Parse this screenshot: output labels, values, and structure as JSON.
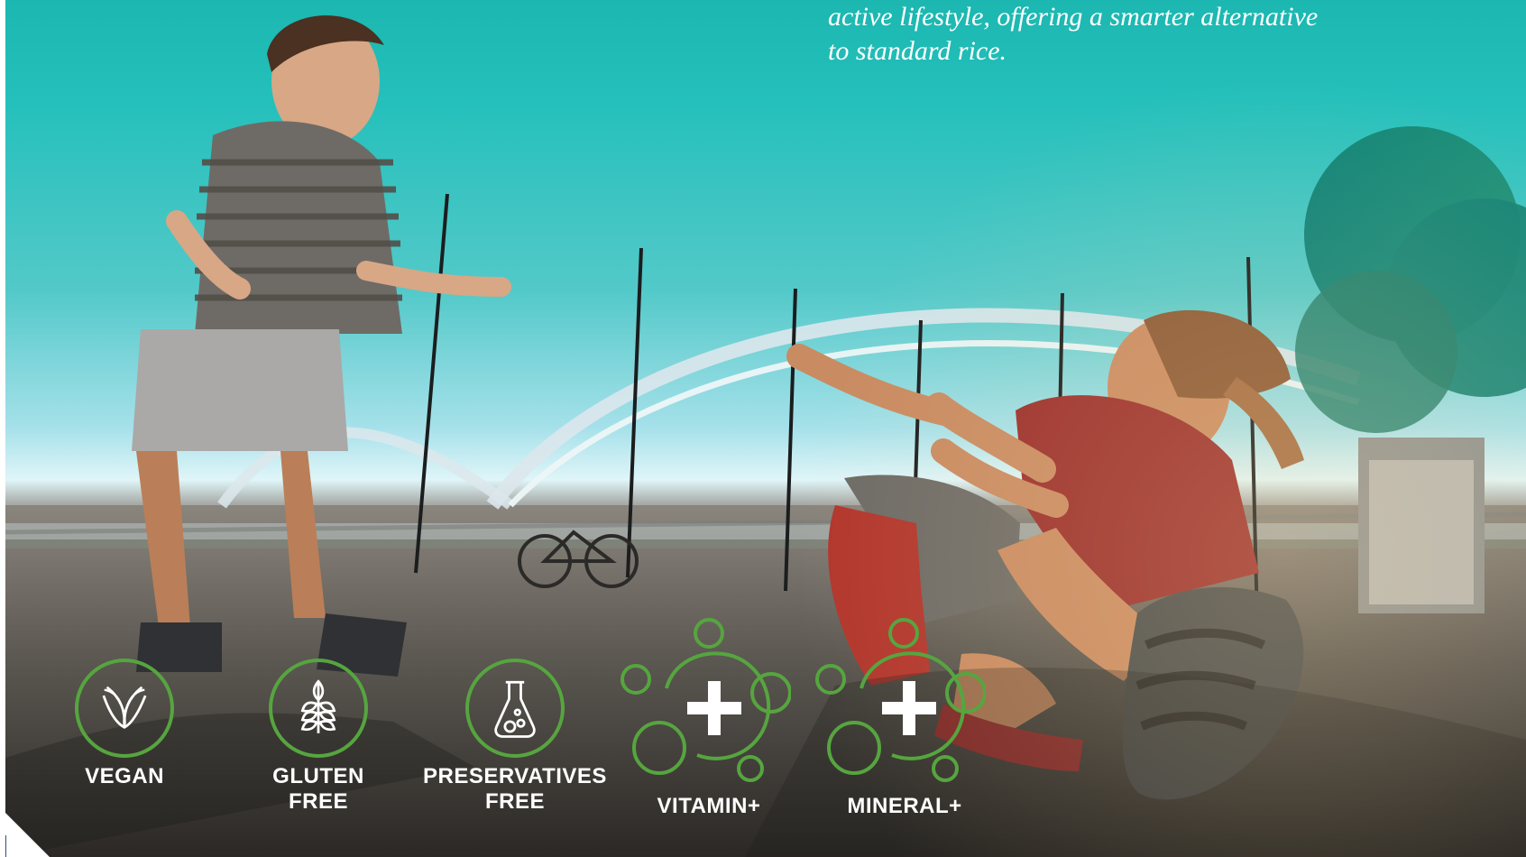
{
  "quote": {
    "line1": "active lifestyle, offering a smarter alternative",
    "line2": "to standard rice."
  },
  "badges": {
    "vegan": "VEGAN",
    "gluten_line1": "GLUTEN",
    "gluten_line2": "FREE",
    "preservatives_line1": "PRESERVATIVES",
    "preservatives_line2": "FREE",
    "vitamin": "VITAMIN+",
    "mineral": "MINERAL+"
  },
  "colors": {
    "badge_green": "#56a53f",
    "sky_teal": "#25c0bb",
    "text_white": "#ffffff"
  },
  "icons": {
    "vegan": "leaf-icon",
    "gluten_free": "wheat-icon",
    "preservatives_free": "flask-icon",
    "vitamin": "plus-bubbles-icon",
    "mineral": "plus-bubbles-icon"
  }
}
